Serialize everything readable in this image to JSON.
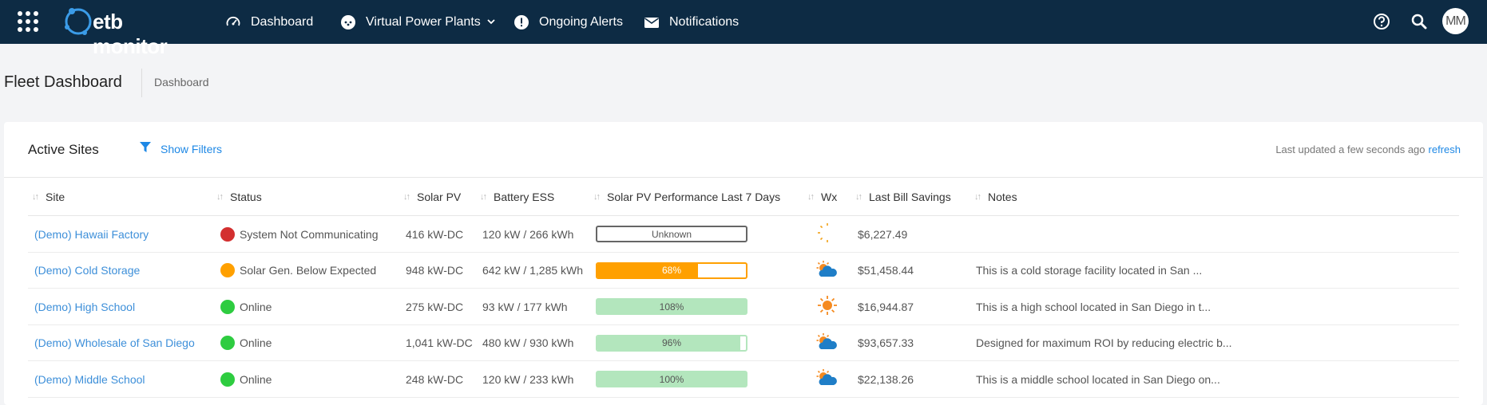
{
  "nav": {
    "logo_text": "etb monitor",
    "items": [
      {
        "label": "Dashboard",
        "icon": "gauge-icon"
      },
      {
        "label": "Virtual Power Plants",
        "icon": "plant-icon"
      },
      {
        "label": "Ongoing Alerts",
        "icon": "alert-icon"
      },
      {
        "label": "Notifications",
        "icon": "envelope-icon"
      }
    ],
    "avatar_initials": "MM"
  },
  "page": {
    "title": "Fleet Dashboard",
    "breadcrumb": "Dashboard"
  },
  "card": {
    "title": "Active Sites",
    "filter_label": "Show Filters",
    "last_updated": "Last updated a few seconds ago",
    "refresh_label": "refresh"
  },
  "table": {
    "columns": [
      "Site",
      "Status",
      "Solar PV",
      "Battery ESS",
      "Solar PV Performance Last 7 Days",
      "Wx",
      "Last Bill Savings",
      "Notes"
    ],
    "rows": [
      {
        "site": "(Demo) Hawaii Factory",
        "status": "System Not Communicating",
        "status_color": "#d32f2f",
        "solar_pv": "416 kW-DC",
        "battery": "120 kW / 266 kWh",
        "perf_label": "Unknown",
        "perf_fraction": 0,
        "perf_style": "unknown",
        "wx": "night-icon",
        "savings": "$6,227.49",
        "notes": ""
      },
      {
        "site": "(Demo) Cold Storage",
        "status": "Solar Gen. Below Expected",
        "status_color": "#ffa000",
        "solar_pv": "948 kW-DC",
        "battery": "642 kW / 1,285 kWh",
        "perf_label": "68%",
        "perf_fraction": 0.68,
        "perf_style": "warning",
        "wx": "partly-cloudy-icon",
        "savings": "$51,458.44",
        "notes": "This is a cold storage facility located in San ..."
      },
      {
        "site": "(Demo) High School",
        "status": "Online",
        "status_color": "#2ecc40",
        "solar_pv": "275 kW-DC",
        "battery": "93 kW / 177 kWh",
        "perf_label": "108%",
        "perf_fraction": 1.0,
        "perf_style": "good",
        "wx": "sun-icon",
        "savings": "$16,944.87",
        "notes": "This is a high school located in San Diego in t..."
      },
      {
        "site": "(Demo) Wholesale of San Diego",
        "status": "Online",
        "status_color": "#2ecc40",
        "solar_pv": "1,041 kW-DC",
        "battery": "480 kW / 930 kWh",
        "perf_label": "96%",
        "perf_fraction": 0.96,
        "perf_style": "good",
        "wx": "partly-cloudy-icon",
        "savings": "$93,657.33",
        "notes": "Designed for maximum ROI by reducing electric b..."
      },
      {
        "site": "(Demo) Middle School",
        "status": "Online",
        "status_color": "#2ecc40",
        "solar_pv": "248 kW-DC",
        "battery": "120 kW / 233 kWh",
        "perf_label": "100%",
        "perf_fraction": 1.0,
        "perf_style": "good",
        "wx": "partly-cloudy-icon",
        "savings": "$22,138.26",
        "notes": "This is a middle school located in San Diego on..."
      }
    ]
  },
  "colors": {
    "nav_bg": "#0d2b44",
    "link": "#3d8fd9",
    "accent": "#1e88e5",
    "perf_good": "#b3e6bd",
    "perf_warning": "#ffa000"
  }
}
